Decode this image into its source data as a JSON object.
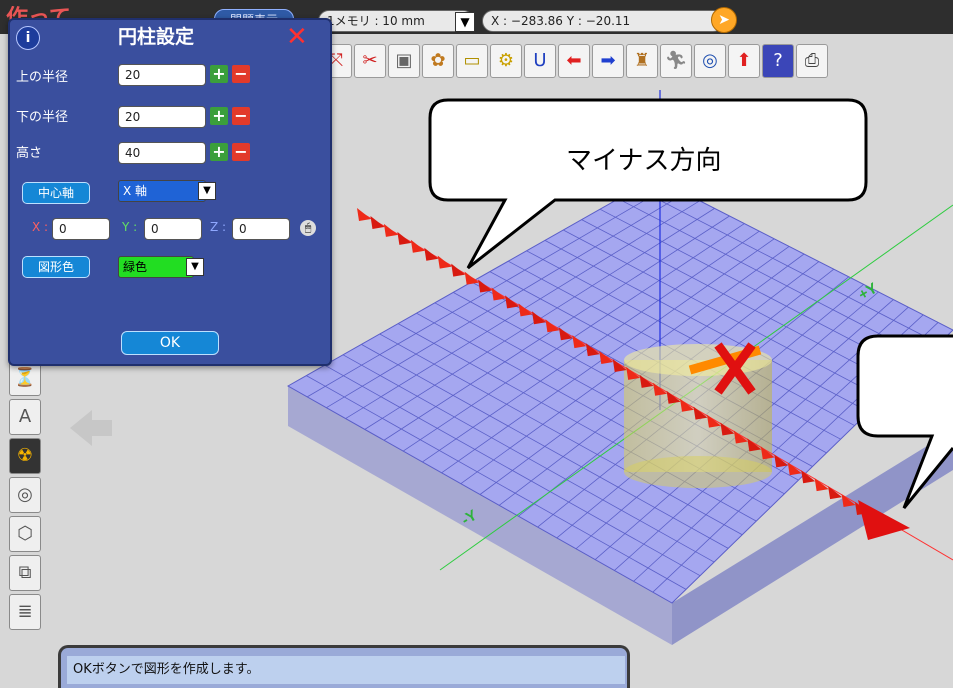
{
  "topbar": {
    "logo_text": "作って",
    "problem_button": "問題表示",
    "memory_label": "1メモリ : 10 mm",
    "coord_readout": "X : −283.86  Y : −20.11"
  },
  "dialog": {
    "title": "円柱設定",
    "rows": [
      {
        "label": "上の半径",
        "value": "20"
      },
      {
        "label": "下の半径",
        "value": "20"
      },
      {
        "label": "高さ",
        "value": "40"
      }
    ],
    "center_axis_label": "中心軸",
    "center_axis_value": "X 軸",
    "x_label": "X :",
    "x_value": "0",
    "y_label": "Y :",
    "y_value": "0",
    "z_label": "Z :",
    "z_value": "0",
    "color_label": "図形色",
    "color_value": "緑色",
    "ok_label": "OK"
  },
  "viewport": {
    "plus_y": "+Y",
    "minus_y": "-Y",
    "callout_text": "マイナス方向"
  },
  "status_text": "OKボタンで図形を作成します。",
  "colors": {
    "dialog_bg": "#3a4f9e",
    "grid": "#8a8fe8",
    "axis_red": "#e01010",
    "accent": "#1587d6"
  }
}
